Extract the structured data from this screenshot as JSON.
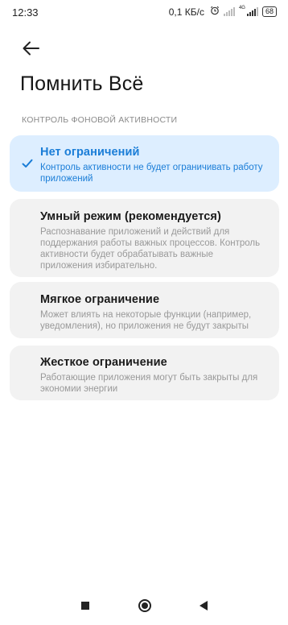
{
  "status_bar": {
    "time": "12:33",
    "net_speed": "0,1 КБ/с",
    "network_type": "4G",
    "battery": "68"
  },
  "header": {
    "back_icon": "arrow-left-icon",
    "title": "Помнить Всё"
  },
  "section": {
    "header": "КОНТРОЛЬ ФОНОВОЙ АКТИВНОСТИ"
  },
  "options": [
    {
      "title": "Нет ограничений",
      "description": "Контроль активности не будет ограничивать работу приложений",
      "selected": true
    },
    {
      "title": "Умный режим (рекомендуется)",
      "description": "Распознавание приложений и действий для поддержания работы важных процессов. Контроль активности будет обрабатывать важные приложения избирательно.",
      "selected": false
    },
    {
      "title": "Мягкое ограничение",
      "description": "Может влиять на некоторые функции (например, уведомления), но приложения не будут закрыты",
      "selected": false
    },
    {
      "title": "Жесткое ограничение",
      "description": "Работающие приложения могут быть закрыты для экономии энергии",
      "selected": false
    }
  ],
  "colors": {
    "accent": "#1a7dd7",
    "selected_bg": "#ddeeff",
    "card_bg": "#f2f2f2"
  },
  "nav_bar": {
    "recents_icon": "square-icon",
    "home_icon": "circle-icon",
    "back_icon": "triangle-back-icon"
  }
}
